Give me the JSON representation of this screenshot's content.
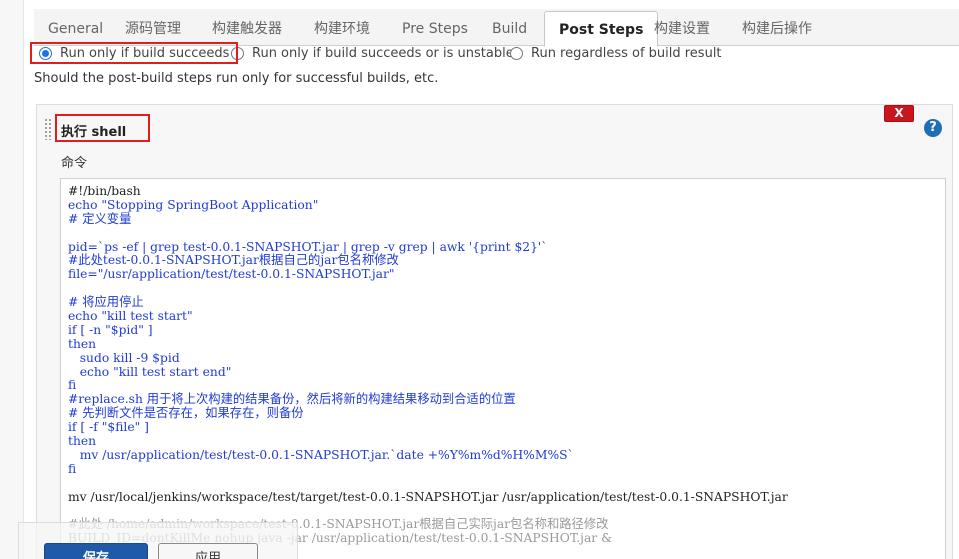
{
  "tabs": [
    {
      "label": "General"
    },
    {
      "label": "源码管理"
    },
    {
      "label": "构建触发器"
    },
    {
      "label": "构建环境"
    },
    {
      "label": "Pre Steps"
    },
    {
      "label": "Build"
    },
    {
      "label": "Post Steps",
      "active": true
    },
    {
      "label": "构建设置"
    },
    {
      "label": "构建后操作"
    }
  ],
  "post_steps": {
    "options": [
      {
        "label": "Run only if build succeeds",
        "checked": true
      },
      {
        "label": "Run only if build succeeds or is unstable",
        "checked": false
      },
      {
        "label": "Run regardless of build result",
        "checked": false
      }
    ],
    "help_text": "Should the post-build steps run only for successful builds, etc."
  },
  "step": {
    "title": "执行 shell",
    "delete_label": "X",
    "help_label": "?",
    "command_label": "命令",
    "code_lines": [
      {
        "text": "#!/bin/bash",
        "color": "black"
      },
      {
        "text": "echo \"Stopping SpringBoot Application\"",
        "color": "blue"
      },
      {
        "text": "# 定义变量",
        "color": "blue"
      },
      {
        "text": "",
        "color": "black"
      },
      {
        "text": "pid=`ps -ef | grep test-0.0.1-SNAPSHOT.jar | grep -v grep | awk '{print $2}'`",
        "color": "blue"
      },
      {
        "text": "#此处test-0.0.1-SNAPSHOT.jar根据自己的jar包名称修改",
        "color": "blue"
      },
      {
        "text": "file=\"/usr/application/test/test-0.0.1-SNAPSHOT.jar\"",
        "color": "blue"
      },
      {
        "text": "",
        "color": "black"
      },
      {
        "text": "# 将应用停止",
        "color": "blue"
      },
      {
        "text": "echo \"kill test start\"",
        "color": "blue"
      },
      {
        "text": "if [ -n \"$pid\" ]",
        "color": "blue"
      },
      {
        "text": "then",
        "color": "blue"
      },
      {
        "text": "   sudo kill -9 $pid",
        "color": "blue"
      },
      {
        "text": "   echo \"kill test start end\"",
        "color": "blue"
      },
      {
        "text": "fi",
        "color": "blue"
      },
      {
        "text": "#replace.sh 用于将上次构建的结果备份，然后将新的构建结果移动到合适的位置",
        "color": "blue"
      },
      {
        "text": "# 先判断文件是否存在，如果存在，则备份",
        "color": "blue"
      },
      {
        "text": "if [ -f \"$file\" ]",
        "color": "blue"
      },
      {
        "text": "then",
        "color": "blue"
      },
      {
        "text": "   mv /usr/application/test/test-0.0.1-SNAPSHOT.jar.`date +%Y%m%d%H%M%S`",
        "color": "blue"
      },
      {
        "text": "fi",
        "color": "blue"
      },
      {
        "text": "",
        "color": "black"
      },
      {
        "text": "mv /usr/local/jenkins/workspace/test/target/test-0.0.1-SNAPSHOT.jar /usr/application/test/test-0.0.1-SNAPSHOT.jar",
        "color": "black"
      },
      {
        "text": "",
        "color": "black"
      },
      {
        "text": "#此处 /home/admin/workspace/test-0.0.1-SNAPSHOT.jar根据自己实际jar包名称和路径修改",
        "color": "gray"
      },
      {
        "text": "BUILD_ID=dontKillMe nohup java -jar /usr/application/test/test-0.0.1-SNAPSHOT.jar &",
        "color": "gray"
      }
    ]
  },
  "buttons": {
    "save_label": "保存",
    "apply_label": "应用"
  }
}
